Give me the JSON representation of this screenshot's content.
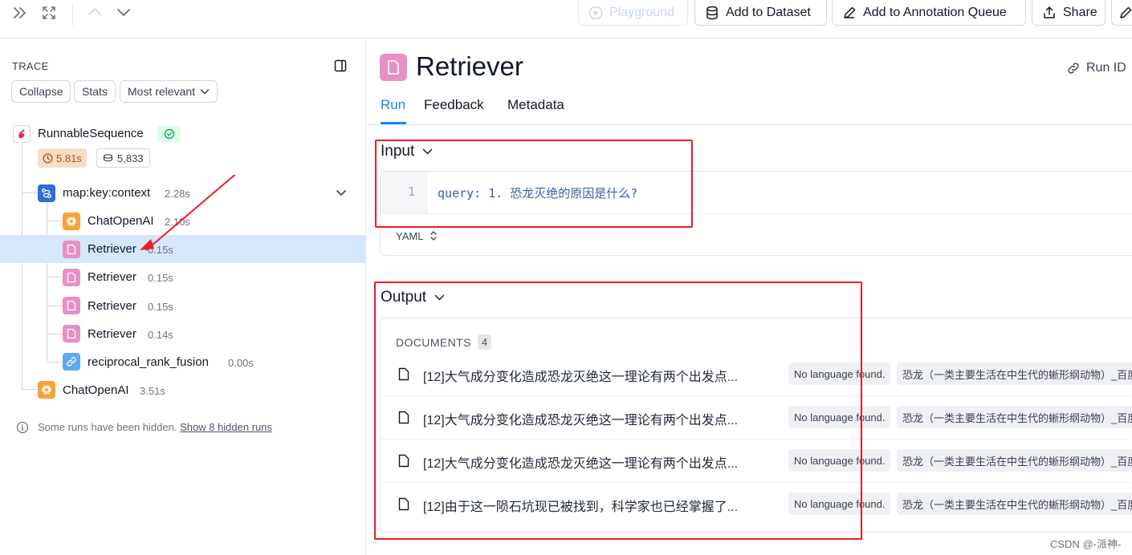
{
  "toolbar": {
    "playground_label": "Playground",
    "add_to_dataset_label": "Add to Dataset",
    "add_to_annotation_queue_label": "Add to Annotation Queue",
    "share_label": "Share"
  },
  "trace": {
    "heading": "TRACE",
    "collapse_label": "Collapse",
    "stats_label": "Stats",
    "sort_label": "Most relevant",
    "root": {
      "name": "RunnableSequence",
      "latency": "5.81s",
      "tokens": "5,833"
    },
    "nodes": [
      {
        "name": "map:key:context",
        "time": "2.28s",
        "type": "chain"
      },
      {
        "name": "ChatOpenAI",
        "time": "2.10s",
        "type": "llm"
      },
      {
        "name": "Retriever",
        "time": "0.15s",
        "type": "retriever",
        "selected": true
      },
      {
        "name": "Retriever",
        "time": "0.15s",
        "type": "retriever"
      },
      {
        "name": "Retriever",
        "time": "0.15s",
        "type": "retriever"
      },
      {
        "name": "Retriever",
        "time": "0.14s",
        "type": "retriever"
      },
      {
        "name": "reciprocal_rank_fusion",
        "time": "0.00s",
        "type": "tool"
      },
      {
        "name": "ChatOpenAI",
        "time": "3.51s",
        "type": "llm"
      }
    ],
    "hidden_note": "Some runs have been hidden.",
    "hidden_link": "Show 8 hidden runs"
  },
  "run": {
    "title": "Retriever",
    "run_id_label": "Run ID",
    "tabs": [
      {
        "label": "Run",
        "active": true
      },
      {
        "label": "Feedback",
        "active": false
      },
      {
        "label": "Metadata",
        "active": false
      }
    ],
    "input": {
      "title": "Input",
      "line_number": "1",
      "code": "query: 1. 恐龙灭绝的原因是什么?",
      "format": "YAML"
    },
    "output": {
      "title": "Output",
      "documents_label": "DOCUMENTS",
      "documents_count": "4",
      "documents": [
        {
          "text": "[12]大气成分变化造成恐龙灭绝这一理论有两个出发点...",
          "lang": "No language found.",
          "source": "恐龙（一类主要生活在中生代的蜥形纲动物）_百度"
        },
        {
          "text": "[12]大气成分变化造成恐龙灭绝这一理论有两个出发点...",
          "lang": "No language found.",
          "source": "恐龙（一类主要生活在中生代的蜥形纲动物）_百度"
        },
        {
          "text": "[12]大气成分变化造成恐龙灭绝这一理论有两个出发点...",
          "lang": "No language found.",
          "source": "恐龙（一类主要生活在中生代的蜥形纲动物）_百度"
        },
        {
          "text": "[12]由于这一陨石坑现已被找到，科学家也已经掌握了...",
          "lang": "No language found.",
          "source": "恐龙（一类主要生活在中生代的蜥形纲动物）_百度"
        }
      ]
    }
  },
  "watermark": "CSDN @-派神-",
  "colors": {
    "accent": "#1b84ff",
    "retriever_icon": "#e88fc4",
    "llm_icon": "#f5a43a",
    "chain_icon": "#2f6fd8",
    "tool_icon": "#5fa8f2",
    "annotation_red": "#ee1d23",
    "success_green": "#22a35a",
    "latency_badge_bg": "#f8dcc4"
  }
}
